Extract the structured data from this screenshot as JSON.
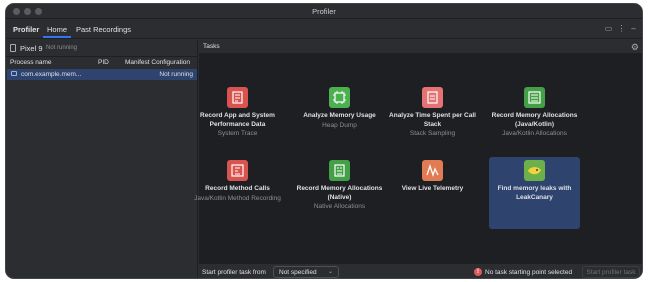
{
  "window": {
    "title": "Profiler"
  },
  "toolbar": {
    "app_title": "Profiler",
    "tabs": [
      "Home",
      "Past Recordings"
    ]
  },
  "device": {
    "name": "Pixel 9",
    "status": "Not running"
  },
  "process_table": {
    "columns": [
      "Process name",
      "PID",
      "Manifest Configuration"
    ],
    "rows": [
      {
        "name": "com.example.mem...",
        "pid": "",
        "config": "Not running"
      }
    ]
  },
  "tasks": {
    "label": "Tasks",
    "items": [
      {
        "title": "Record App and System Performance Data",
        "subtitle": "System Trace",
        "icon": "system-trace-icon",
        "color": "#d9534f"
      },
      {
        "title": "Analyze Memory Usage",
        "subtitle": "Heap Dump",
        "icon": "heap-dump-icon",
        "color": "#4caf50"
      },
      {
        "title": "Analyze Time Spent per Call Stack",
        "subtitle": "Stack Sampling",
        "icon": "stack-sampling-icon",
        "color": "#e57373"
      },
      {
        "title": "Record Memory Allocations (Java/Kotlin)",
        "subtitle": "Java/Kotlin Allocations",
        "icon": "java-allocations-icon",
        "color": "#43a047"
      },
      {
        "title": "Record Method Calls",
        "subtitle": "Java/Kotlin Method Recording",
        "icon": "method-recording-icon",
        "color": "#d9534f"
      },
      {
        "title": "Record Memory Allocations (Native)",
        "subtitle": "Native Allocations",
        "icon": "native-allocations-icon",
        "color": "#43a047"
      },
      {
        "title": "View Live Telemetry",
        "subtitle": "",
        "icon": "live-telemetry-icon",
        "color": "#e07b53"
      },
      {
        "title": "Find memory leaks with LeakCanary",
        "subtitle": "",
        "icon": "leakcanary-icon",
        "color": "#6bb04a"
      }
    ],
    "selected_index": 7
  },
  "footer": {
    "start_label": "Start profiler task from",
    "dropdown_value": "Not specified",
    "warning_text": "No task starting point selected",
    "start_button": "Start profiler task"
  }
}
